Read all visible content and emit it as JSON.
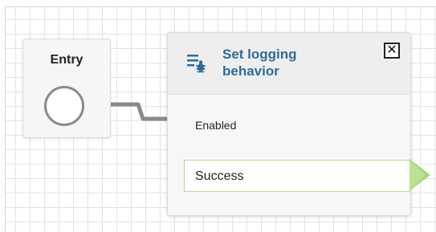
{
  "entry": {
    "title": "Entry"
  },
  "block": {
    "title_line1": "Set logging",
    "title_line2": "behavior",
    "icon": "list-bug-icon",
    "close_label": "✕",
    "input_label": "Enabled",
    "branch_label": "Success"
  },
  "colors": {
    "title": "#2e6b9b",
    "connector": "#8a8a8a",
    "success_branch": "#a8d87a"
  }
}
